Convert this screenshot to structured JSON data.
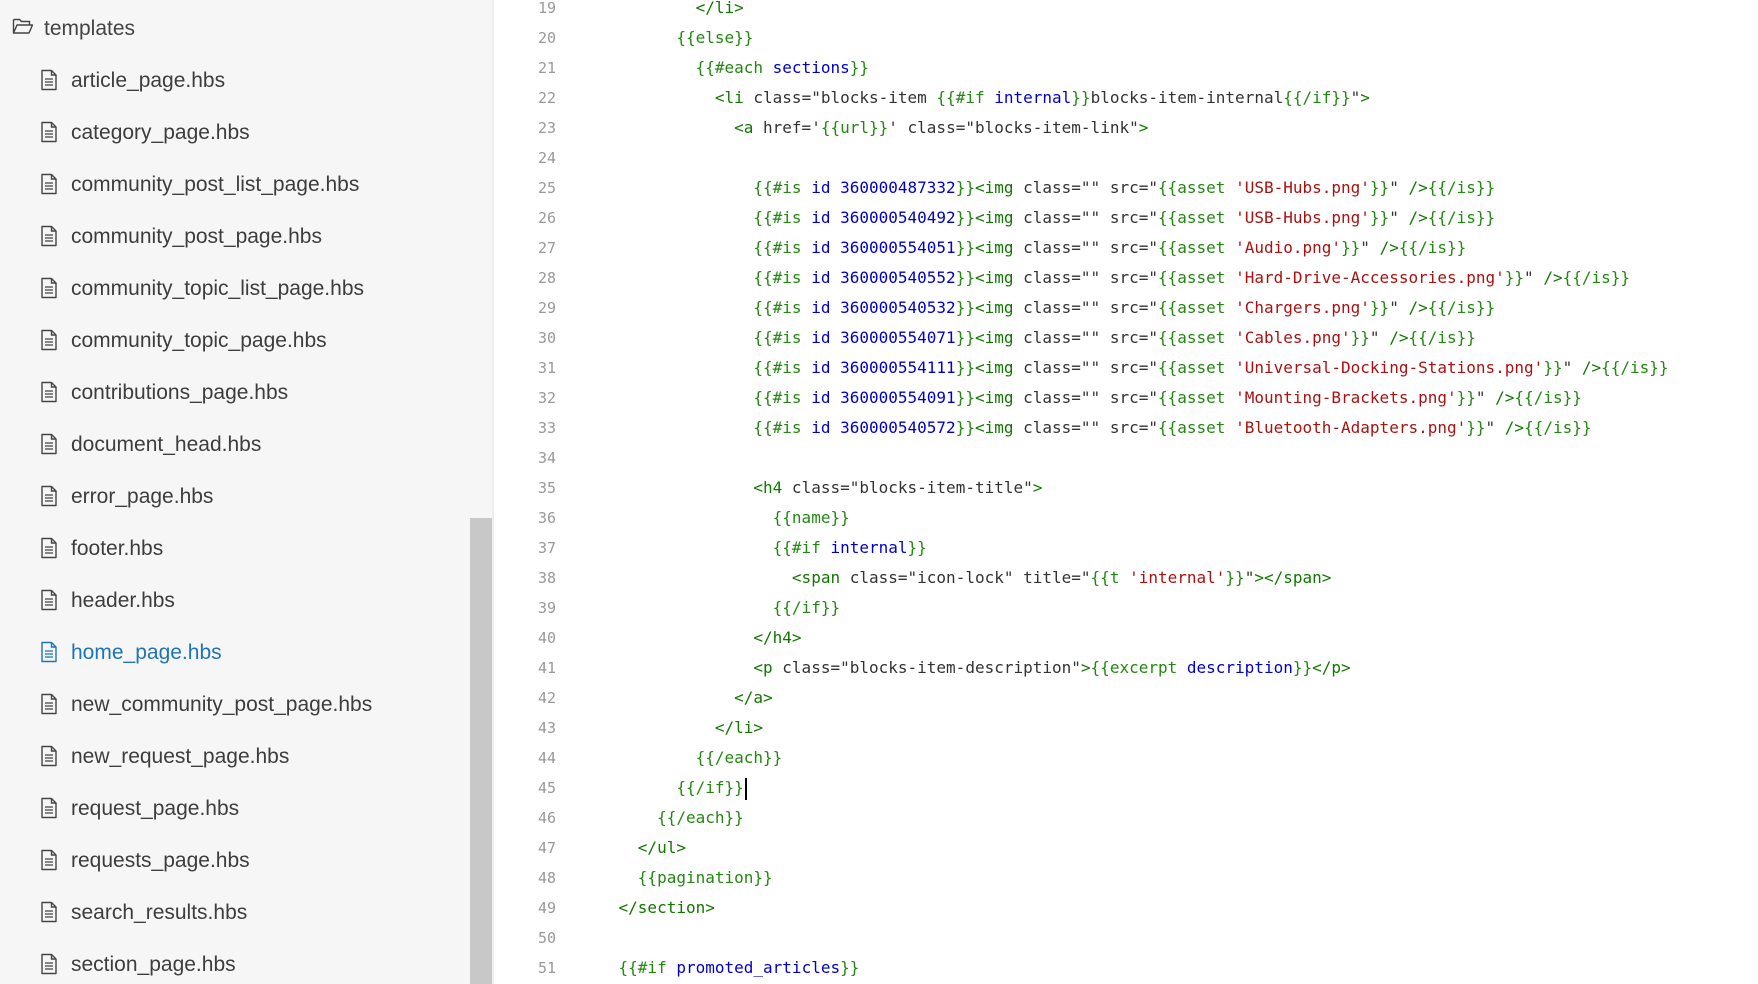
{
  "sidebar": {
    "folder": {
      "icon": "folder-open-icon",
      "label": "templates"
    },
    "files": [
      {
        "label": "article_page.hbs"
      },
      {
        "label": "category_page.hbs"
      },
      {
        "label": "community_post_list_page.hbs"
      },
      {
        "label": "community_post_page.hbs"
      },
      {
        "label": "community_topic_list_page.hbs"
      },
      {
        "label": "community_topic_page.hbs"
      },
      {
        "label": "contributions_page.hbs"
      },
      {
        "label": "document_head.hbs"
      },
      {
        "label": "error_page.hbs"
      },
      {
        "label": "footer.hbs"
      },
      {
        "label": "header.hbs"
      },
      {
        "label": "home_page.hbs",
        "active": true
      },
      {
        "label": "new_community_post_page.hbs"
      },
      {
        "label": "new_request_page.hbs"
      },
      {
        "label": "request_page.hbs"
      },
      {
        "label": "requests_page.hbs"
      },
      {
        "label": "search_results.hbs"
      },
      {
        "label": "section_page.hbs"
      }
    ]
  },
  "colors": {
    "tag": "#117700",
    "attr": "#0000cc",
    "string": "#aa1111",
    "handlebars": "#228811",
    "active_file": "#1f73b7",
    "line_number": "#999999"
  },
  "editor": {
    "lines": [
      {
        "n": "19",
        "code": "            </li>"
      },
      {
        "n": "20",
        "code": "          {{else}}"
      },
      {
        "n": "21",
        "code": "            {{#each sections}}"
      },
      {
        "n": "22",
        "code": "              <li class=\"blocks-item {{#if internal}}blocks-item-internal{{/if}}\">"
      },
      {
        "n": "23",
        "code": "                <a href='{{url}}' class=\"blocks-item-link\">"
      },
      {
        "n": "24",
        "code": ""
      },
      {
        "n": "25",
        "code": "                  {{#is id 360000487332}}<img class=\"\" src=\"{{asset 'USB-Hubs.png'}}\" />{{/is}}"
      },
      {
        "n": "26",
        "code": "                  {{#is id 360000540492}}<img class=\"\" src=\"{{asset 'USB-Hubs.png'}}\" />{{/is}}"
      },
      {
        "n": "27",
        "code": "                  {{#is id 360000554051}}<img class=\"\" src=\"{{asset 'Audio.png'}}\" />{{/is}}"
      },
      {
        "n": "28",
        "code": "                  {{#is id 360000540552}}<img class=\"\" src=\"{{asset 'Hard-Drive-Accessories.png'}}\" />{{/is}}"
      },
      {
        "n": "29",
        "code": "                  {{#is id 360000540532}}<img class=\"\" src=\"{{asset 'Chargers.png'}}\" />{{/is}}"
      },
      {
        "n": "30",
        "code": "                  {{#is id 360000554071}}<img class=\"\" src=\"{{asset 'Cables.png'}}\" />{{/is}}"
      },
      {
        "n": "31",
        "code": "                  {{#is id 360000554111}}<img class=\"\" src=\"{{asset 'Universal-Docking-Stations.png'}}\" />{{/is}}"
      },
      {
        "n": "32",
        "code": "                  {{#is id 360000554091}}<img class=\"\" src=\"{{asset 'Mounting-Brackets.png'}}\" />{{/is}}"
      },
      {
        "n": "33",
        "code": "                  {{#is id 360000540572}}<img class=\"\" src=\"{{asset 'Bluetooth-Adapters.png'}}\" />{{/is}}"
      },
      {
        "n": "34",
        "code": ""
      },
      {
        "n": "35",
        "code": "                  <h4 class=\"blocks-item-title\">"
      },
      {
        "n": "36",
        "code": "                    {{name}}"
      },
      {
        "n": "37",
        "code": "                    {{#if internal}}"
      },
      {
        "n": "38",
        "code": "                      <span class=\"icon-lock\" title=\"{{t 'internal'}}\"></span>"
      },
      {
        "n": "39",
        "code": "                    {{/if}}"
      },
      {
        "n": "40",
        "code": "                  </h4>"
      },
      {
        "n": "41",
        "code": "                  <p class=\"blocks-item-description\">{{excerpt description}}</p>"
      },
      {
        "n": "42",
        "code": "                </a>"
      },
      {
        "n": "43",
        "code": "              </li>"
      },
      {
        "n": "44",
        "code": "            {{/each}}"
      },
      {
        "n": "45",
        "code": "          {{/if}}",
        "cursor": true
      },
      {
        "n": "46",
        "code": "        {{/each}}"
      },
      {
        "n": "47",
        "code": "      </ul>"
      },
      {
        "n": "48",
        "code": "      {{pagination}}"
      },
      {
        "n": "49",
        "code": "    </section>"
      },
      {
        "n": "50",
        "code": ""
      },
      {
        "n": "51",
        "code": "    {{#if promoted_articles}}"
      }
    ]
  }
}
